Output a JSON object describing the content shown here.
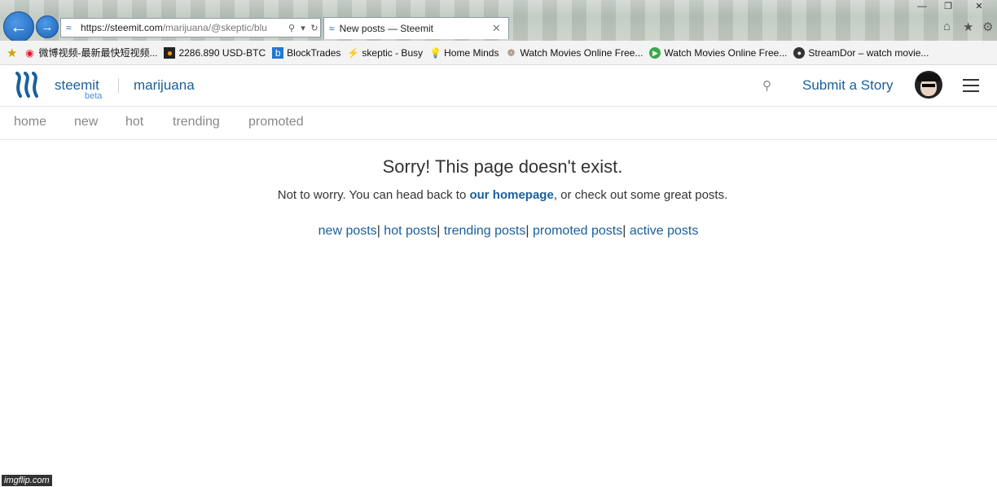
{
  "browser": {
    "url_host": "https://steemit.com",
    "url_path": "/marijuana/@skeptic/blu",
    "tab_title": "New posts — Steemit",
    "window_controls": [
      "—",
      "❐",
      "✕"
    ]
  },
  "favorites": [
    {
      "label": "微博视频-最新最快短视频...",
      "icon": "weibo-icon",
      "color": "#e6162d"
    },
    {
      "label": "2286.890 USD-BTC",
      "icon": "bitcoin-icon",
      "color": "#f7931a"
    },
    {
      "label": "BlockTrades",
      "icon": "blocktrades-icon",
      "color": "#1f78d1"
    },
    {
      "label": "skeptic - Busy",
      "icon": "lightning-icon",
      "color": "#222222"
    },
    {
      "label": "Home  Minds",
      "icon": "bulb-icon",
      "color": "#f2c200"
    },
    {
      "label": "Watch Movies Online Free...",
      "icon": "film-reel-icon",
      "color": "#8a7a55"
    },
    {
      "label": "Watch Movies Online Free...",
      "icon": "play-icon",
      "color": "#3aa84a"
    },
    {
      "label": "StreamDor – watch movie...",
      "icon": "streamdor-icon",
      "color": "#333333"
    }
  ],
  "header": {
    "brand": "steemit",
    "beta": "beta",
    "topic": "marijuana",
    "submit": "Submit a Story"
  },
  "subnav": [
    "home",
    "new",
    "hot",
    "trending",
    "promoted"
  ],
  "main": {
    "heading": "Sorry! This page doesn't exist.",
    "para_before": "Not to worry. You can head back to ",
    "para_link": "our homepage",
    "para_after": ", or check out some great posts.",
    "links": [
      "new posts",
      "hot posts",
      "trending posts",
      "promoted posts",
      "active posts"
    ],
    "link_separator": "|"
  },
  "colors": {
    "accent": "#1a5f9b",
    "muted": "#888888",
    "text": "#333333"
  },
  "watermark": "imgflip.com"
}
